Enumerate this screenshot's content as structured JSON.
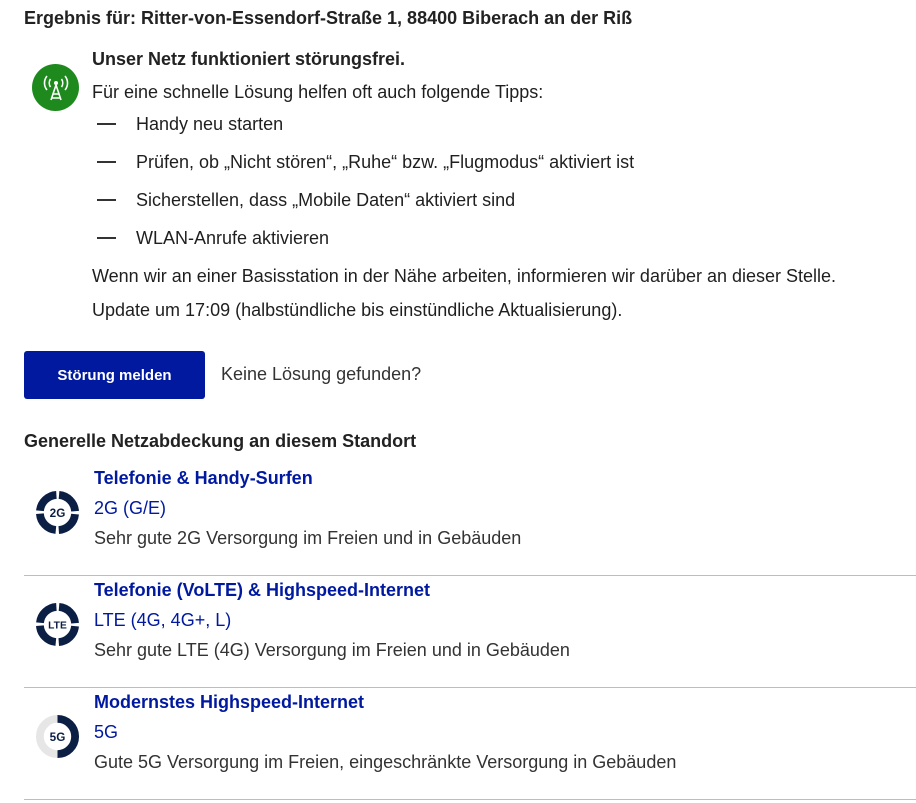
{
  "result": {
    "title": "Ergebnis für: Ritter-von-Essendorf-Straße 1, 88400 Biberach an der Riß"
  },
  "status": {
    "icon": "antenna-tower-icon",
    "color": "#1e8a1e",
    "heading": "Unser Netz funktioniert störungsfrei.",
    "intro": "Für eine schnelle Lösung helfen oft auch folgende Tipps:",
    "tips": [
      "Handy neu starten",
      "Prüfen, ob „Nicht stören“, „Ruhe“ bzw. „Flugmodus“ aktiviert ist",
      "Sicherstellen, dass „Mobile Daten“ aktiviert sind",
      "WLAN-Anrufe aktivieren"
    ],
    "info": "Wenn wir an einer Basisstation in der Nähe arbeiten, informieren wir darüber an dieser Stelle.",
    "update": "Update um 17:09 (halbstündliche bis einstündliche Aktualisierung)."
  },
  "actions": {
    "report_button": "Störung melden",
    "no_solution": "Keine Lösung gefunden?",
    "accent": "#00199f"
  },
  "coverage": {
    "title": "Generelle Netzabdeckung an diesem Standort",
    "items": [
      {
        "name": "Telefonie & Handy-Surfen",
        "tech": "2G (G/E)",
        "badge": "2G",
        "description": "Sehr gute 2G Versorgung im Freien und in Gebäuden",
        "level": 1.0
      },
      {
        "name": "Telefonie (VoLTE) & Highspeed-Internet",
        "tech": "LTE (4G, 4G+, L)",
        "badge": "LTE",
        "description": "Sehr gute LTE (4G) Versorgung im Freien und in Gebäuden",
        "level": 1.0
      },
      {
        "name": "Modernstes Highspeed-Internet",
        "tech": "5G",
        "badge": "5G",
        "description": "Gute 5G Versorgung im Freien, eingeschränkte Versorgung in Gebäuden",
        "level": 0.5
      }
    ]
  }
}
